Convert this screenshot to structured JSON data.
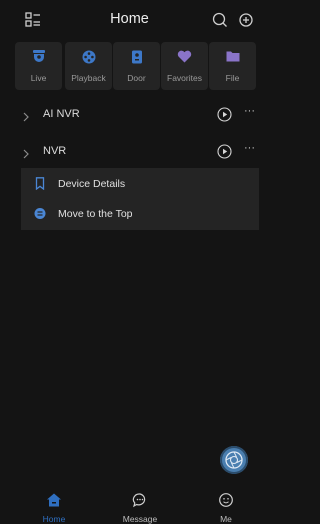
{
  "header": {
    "title": "Home",
    "menu_icon": "grid-list-icon",
    "search_icon": "search-icon",
    "add_icon": "plus-circle-icon"
  },
  "quick_actions": [
    {
      "label": "Live",
      "icon": "camera-icon"
    },
    {
      "label": "Playback",
      "icon": "film-reel-icon"
    },
    {
      "label": "Door",
      "icon": "door-lock-icon"
    },
    {
      "label": "Favorites",
      "icon": "heart-icon"
    },
    {
      "label": "File",
      "icon": "folder-icon"
    }
  ],
  "devices": [
    {
      "name": "AI NVR"
    },
    {
      "name": "NVR"
    }
  ],
  "context_menu": {
    "items": [
      {
        "label": "Device Details",
        "icon": "bookmark-icon"
      },
      {
        "label": "Move to the Top",
        "icon": "move-top-icon"
      }
    ]
  },
  "more_glyph": "···",
  "bottom_nav": [
    {
      "label": "Home",
      "icon": "home-icon",
      "active": true
    },
    {
      "label": "Message",
      "icon": "chat-icon",
      "active": false
    },
    {
      "label": "Me",
      "icon": "smiley-icon",
      "active": false
    }
  ],
  "colors": {
    "accent": "#2f6fc0",
    "background": "#141414",
    "tile": "#242424",
    "icon_blue": "#3d78c8",
    "icon_purple": "#8a74c9"
  }
}
